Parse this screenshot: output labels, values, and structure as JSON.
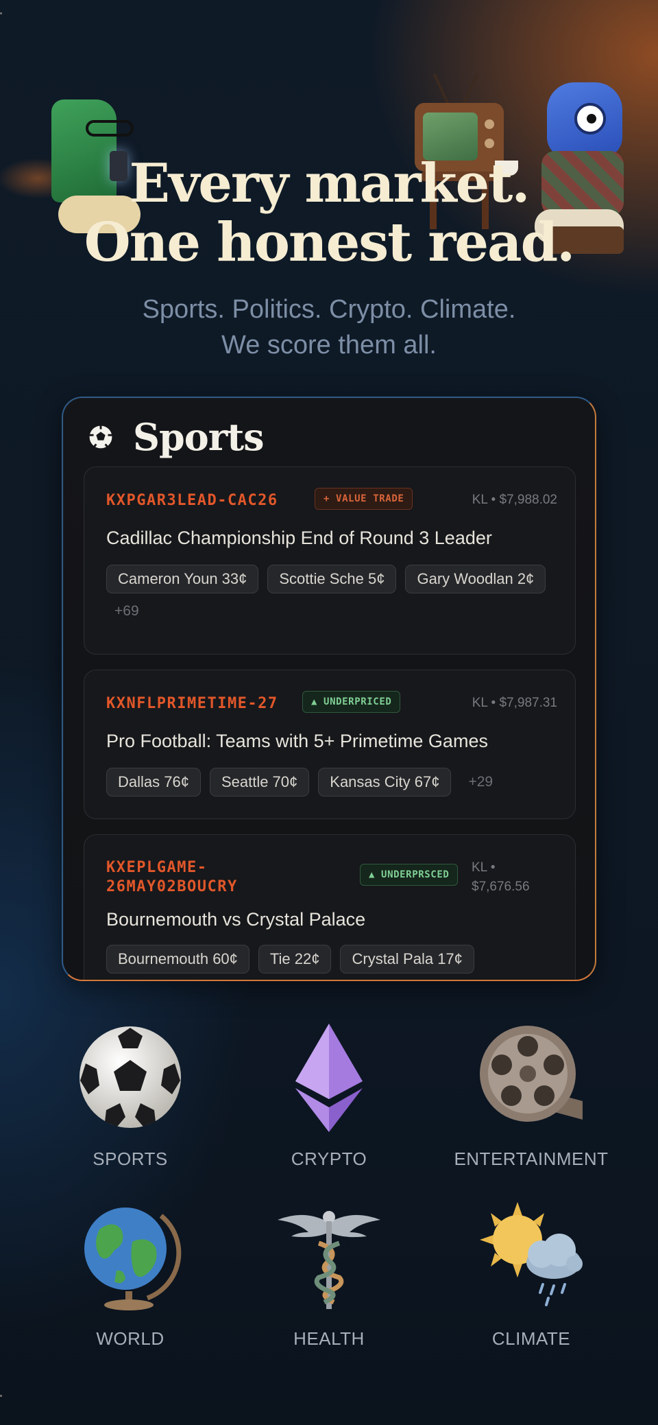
{
  "hero": {
    "title_line1": "Every market.",
    "title_line2": "One honest read.",
    "subtitle_line1": "Sports. Politics. Crypto. Climate.",
    "subtitle_line2": "We score them all."
  },
  "sports_card": {
    "title": "Sports",
    "icon": "soccer-ball-icon",
    "markets": [
      {
        "ticker": "KXPGAR3LEAD-CAC26",
        "badge": "+ VALUE TRADE",
        "meta": "KL • $7,988.02",
        "title": "Cadillac Championship End of Round 3 Leader",
        "chips": [
          "Cameron Youn 33¢",
          "Scottie Sche 5¢",
          "Gary Woodlan 2¢"
        ],
        "more": "+69"
      },
      {
        "ticker": "KXNFLPRIMETIME-27",
        "badge": "▲ UNDERPRICED",
        "meta": "KL • $7,987.31",
        "title": "Pro Football: Teams with 5+ Primetime Games",
        "chips": [
          "Dallas 76¢",
          "Seattle 70¢",
          "Kansas City 67¢"
        ],
        "more": "+29"
      },
      {
        "ticker_line1": "KXEPLGAME-",
        "ticker_line2": "26MAY02BOUCRY",
        "badge": "▲ UNDERPRSCED",
        "meta_line1": "KL •",
        "meta_line2": "$7,676.56",
        "title": "Bournemouth vs Crystal Palace",
        "chips": [
          "Bournemouth 60¢",
          "Tie 22¢",
          "Crystal Pala 17¢"
        ]
      }
    ]
  },
  "categories": [
    {
      "label": "SPORTS",
      "icon": "soccer-ball-icon"
    },
    {
      "label": "CRYPTO",
      "icon": "ethereum-icon"
    },
    {
      "label": "ENTERTAINMENT",
      "icon": "film-reel-icon"
    },
    {
      "label": "WORLD",
      "icon": "globe-icon"
    },
    {
      "label": "HEALTH",
      "icon": "caduceus-icon"
    },
    {
      "label": "CLIMATE",
      "icon": "sun-cloud-icon"
    }
  ],
  "colors": {
    "accent_orange": "#e2572a",
    "badge_green": "#7fcf94",
    "title_cream": "#f5ecd2",
    "subtitle_blue_gray": "#7d8ea6"
  }
}
